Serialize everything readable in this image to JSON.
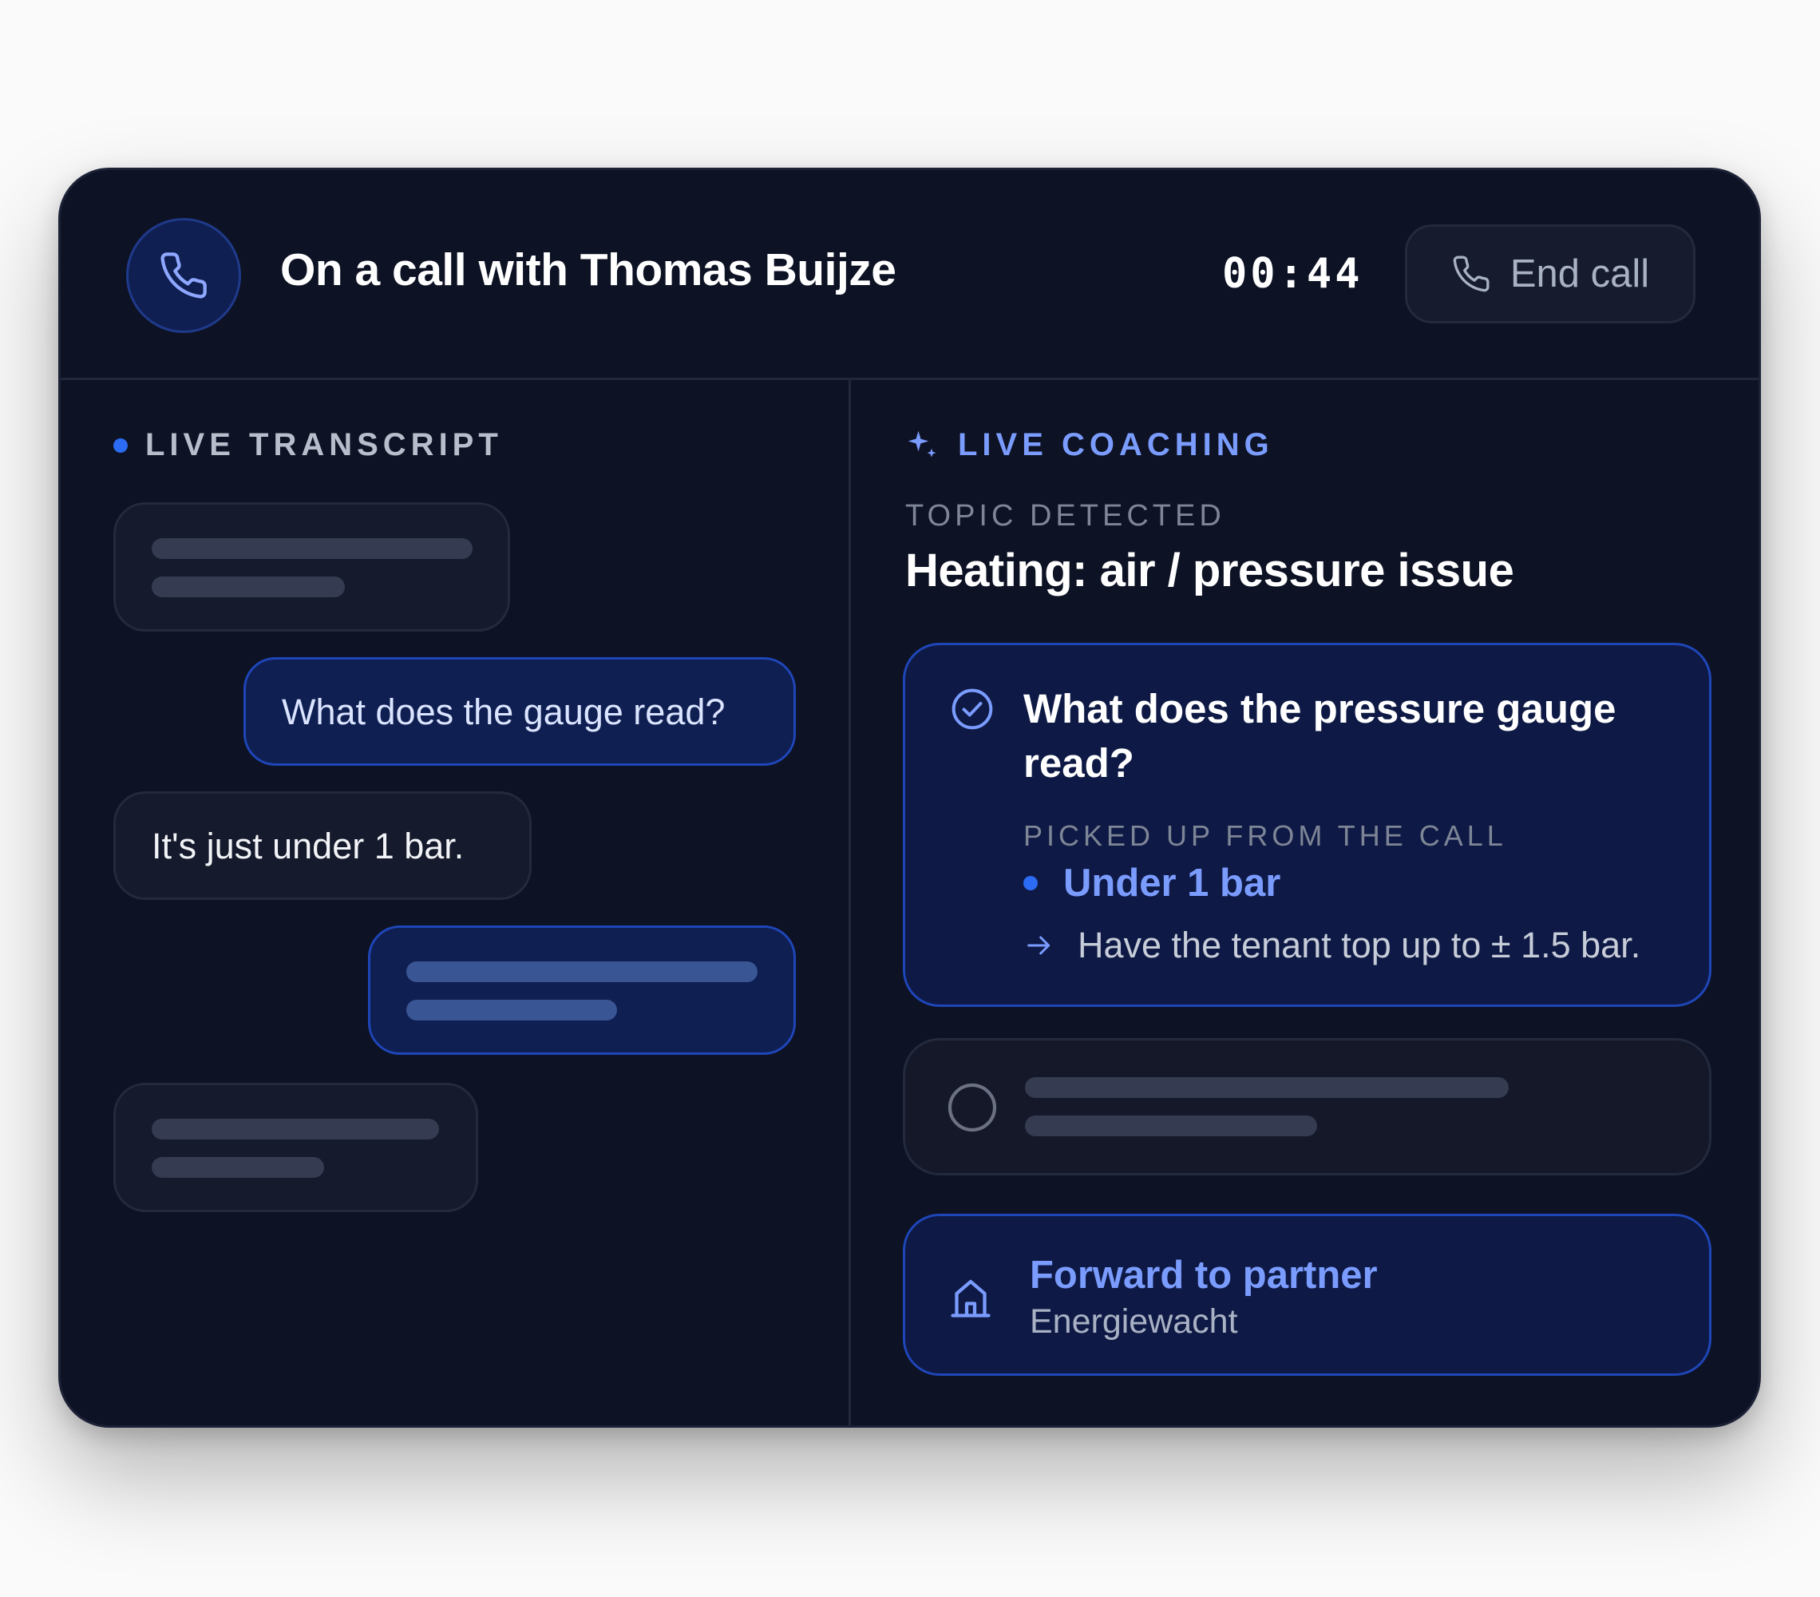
{
  "header": {
    "title": "On a call with Thomas Buijze",
    "timer": "00:44",
    "end_call_label": "End call",
    "phone_icon": "phone-icon"
  },
  "transcript": {
    "label": "LIVE TRANSCRIPT",
    "messages": [
      {
        "side": "in",
        "text": ""
      },
      {
        "side": "out",
        "text": "What does the gauge read?"
      },
      {
        "side": "in",
        "text": "It's just under 1 bar."
      },
      {
        "side": "out",
        "text": ""
      },
      {
        "side": "in",
        "text": ""
      }
    ]
  },
  "coaching": {
    "label": "LIVE COACHING",
    "topic_label": "TOPIC DETECTED",
    "topic": "Heating: air / pressure issue",
    "question": {
      "line1": "What does the pressure gauge",
      "line2": "read?",
      "picked_label": "PICKED UP FROM THE CALL",
      "answer": "Under 1 bar",
      "advice": "Have the tenant top up to ± 1.5 bar."
    },
    "partner": {
      "title": "Forward to partner",
      "name": "Energiewacht"
    }
  },
  "colors": {
    "background": "#0d1224",
    "accent": "#2c6bf3",
    "accent_text": "#7b9cff"
  }
}
